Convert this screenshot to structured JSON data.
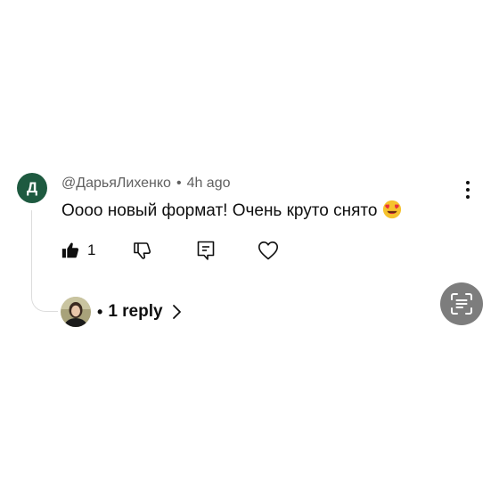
{
  "comment": {
    "author_initial": "Д",
    "author_avatar_color": "#1e5a40",
    "author": "@ДарьяЛихенко",
    "separator": "•",
    "time": "4h ago",
    "text": "Оооо новый формат! Очень круто снято",
    "emoji_icon": "heart-eyes-emoji-icon",
    "like_count": "1"
  },
  "actions": {
    "like_icon": "thumbs-up-filled-icon",
    "dislike_icon": "thumbs-down-icon",
    "reply_icon": "comment-reply-icon",
    "heart_icon": "heart-outline-icon",
    "more_icon": "more-vertical-icon"
  },
  "replies": {
    "dot": "•",
    "label": "1 reply",
    "chevron_icon": "chevron-right-icon"
  },
  "overlay": {
    "lens_icon": "visual-search-icon",
    "lens_color": "#7d7d7d"
  }
}
